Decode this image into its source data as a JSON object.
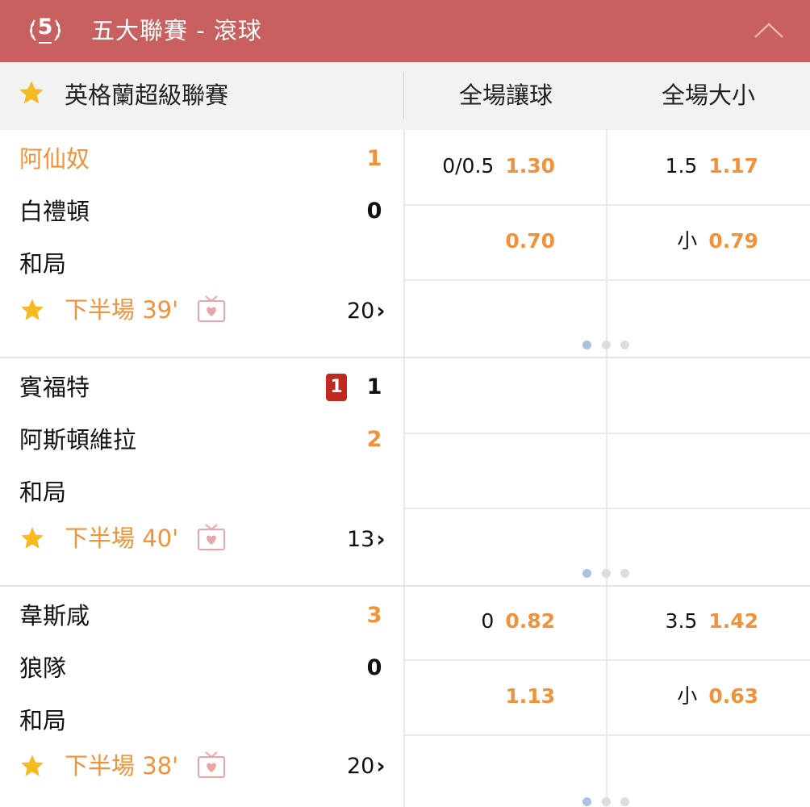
{
  "topbar": {
    "logo_text": "5",
    "title": "五大聯賽 - 滾球",
    "collapse_icon": "chevron-up-icon",
    "bg_color": "#c96060"
  },
  "league": {
    "name": "英格蘭超級聯賽",
    "col_handicap": "全場讓球",
    "col_total": "全場大小"
  },
  "colors": {
    "accent": "#f0923a",
    "red_card": "#c0291f",
    "dot_active": "#a9c2dd"
  },
  "matches": [
    {
      "home": {
        "name": "阿仙奴",
        "score": "1"
      },
      "away": {
        "name": "白禮頓",
        "score": "0"
      },
      "draw": "和局",
      "time": "下半場 39'",
      "more": "20",
      "odds": {
        "hdp_line": "0/0.5",
        "hdp_home": "1.30",
        "hdp_away": "0.70",
        "ou_line": "1.5",
        "ou_over": "1.17",
        "ou_under_label": "小",
        "ou_under": "0.79"
      }
    },
    {
      "home": {
        "name": "賓福特",
        "score": "1",
        "red_cards": "1"
      },
      "away": {
        "name": "阿斯頓維拉",
        "score": "2"
      },
      "draw": "和局",
      "time": "下半場 40'",
      "more": "13"
    },
    {
      "home": {
        "name": "韋斯咸",
        "score": "3"
      },
      "away": {
        "name": "狼隊",
        "score": "0"
      },
      "draw": "和局",
      "time": "下半場 38'",
      "more": "20",
      "odds": {
        "hdp_line": "0",
        "hdp_home": "0.82",
        "hdp_away": "1.13",
        "ou_line": "3.5",
        "ou_over": "1.42",
        "ou_under_label": "小",
        "ou_under": "0.63"
      }
    }
  ]
}
